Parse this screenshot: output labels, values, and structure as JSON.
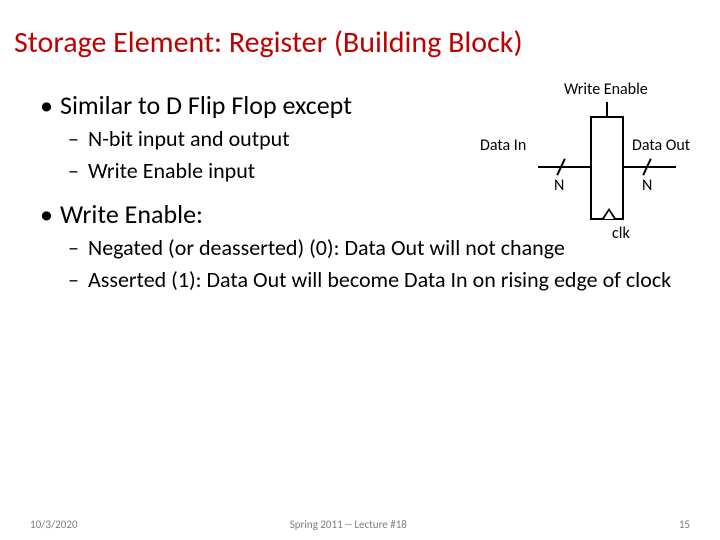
{
  "title": "Storage Element: Register (Building Block)",
  "bullets": {
    "b1": "Similar to D Flip Flop except",
    "b1_sub1": "N-bit input and output",
    "b1_sub2": "Write Enable input",
    "b2": "Write Enable:",
    "b2_sub1": "Negated (or deasserted) (0): Data Out will not change",
    "b2_sub2": "Asserted (1): Data Out will become Data In on rising edge of clock"
  },
  "diagram": {
    "write_enable": "Write Enable",
    "data_in": "Data In",
    "data_out": "Data Out",
    "n_in": "N",
    "n_out": "N",
    "clk": "clk"
  },
  "footer": {
    "date": "10/3/2020",
    "middle": "Spring 2011 -- Lecture #18",
    "page": "15"
  }
}
